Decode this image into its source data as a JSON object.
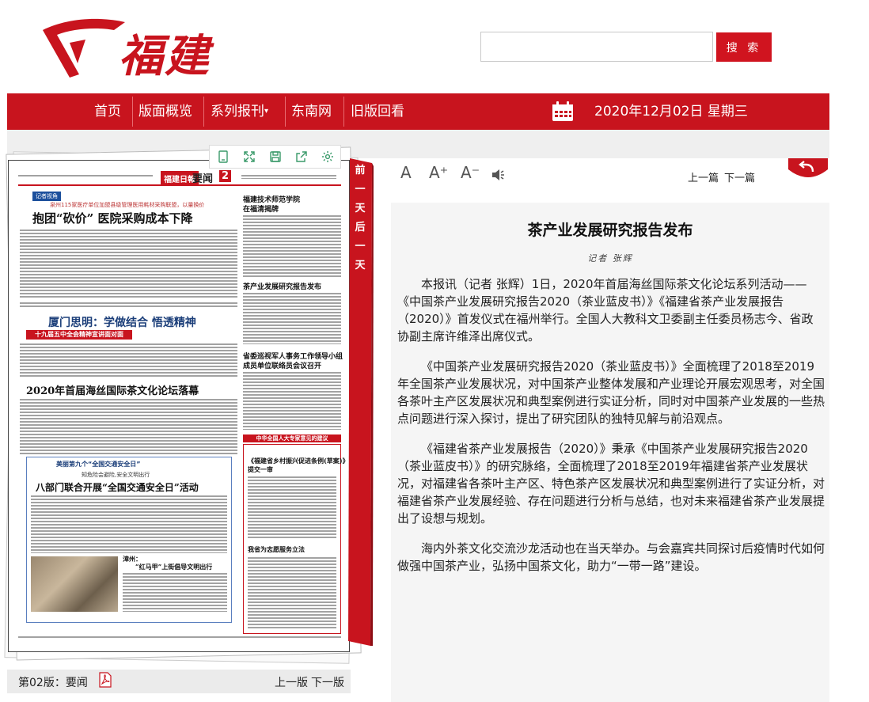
{
  "header": {
    "logo_text": "福建日報",
    "search": {
      "placeholder": "",
      "button_label": "搜 索"
    }
  },
  "nav": {
    "items": [
      "首页",
      "版面概览",
      "系列报刊",
      "东南网",
      "旧版回看"
    ],
    "dropdown_marker": "▾",
    "date": "2020年12月02日 星期三"
  },
  "newspaper": {
    "masthead": "福建日報",
    "section": "要闻",
    "page_no": "2",
    "tag": "记者视角",
    "kicker": "泉州115家医疗单位加盟县级管理医用耗材采购联盟，以量换价",
    "headline_1": "抱团“砍价” 医院采购成本下降",
    "headline_2": "厦门思明：学做结合 悟透精神",
    "red_bar_1": "十九届五中全会精神宣讲面对面",
    "headline_3": "2020年首届海丝国际茶文化论坛落幕",
    "small_head_1": "福建技术师范学院",
    "small_head_1b": "在福清揭牌",
    "small_head_2": "茶产业发展研究报告发布",
    "small_head_3": "省委巡视军人事务工作领导小组",
    "small_head_3b": "成员单位联络员会议召开",
    "red_bar_2": "中华全国人大专家意见的建议",
    "small_head_4": "《福建省乡村振兴促进条例(草案)》",
    "small_head_4b": "提交一审",
    "small_head_5": "我省为志愿服务立法",
    "boxed_kicker": "美丽第九个“全国交通安全日”",
    "boxed_sub": "知危险会避险,安全文明出行",
    "headline_4": "八部门联合开展“全国交通安全日”活动",
    "small_head_6": "漳州：",
    "small_head_6b": "“红马甲”上街倡导文明出行"
  },
  "page_footer": {
    "label": "第02版：要闻",
    "prev": "上一版",
    "next": "下一版"
  },
  "ribbon": {
    "chars": [
      "前",
      "一",
      "天",
      "后",
      "一",
      "天"
    ]
  },
  "article_tools": {
    "font_normal": "A",
    "font_larger": "A⁺",
    "font_smaller": "A⁻",
    "prev": "上一篇",
    "next": "下一篇"
  },
  "article": {
    "title": "茶产业发展研究报告发布",
    "author": "记者 张辉",
    "paragraphs": [
      "本报讯（记者 张辉）1日，2020年首届海丝国际茶文化论坛系列活动——《中国茶产业发展研究报告2020（茶业蓝皮书）》《福建省茶产业发展报告（2020）》首发仪式在福州举行。全国人大教科文卫委副主任委员杨志今、省政协副主席许维泽出席仪式。",
      "《中国茶产业发展研究报告2020（茶业蓝皮书）》全面梳理了2018至2019年全国茶产业发展状况，对中国茶产业整体发展和产业理论开展宏观思考，对全国各茶叶主产区发展状况和典型案例进行实证分析，同时对中国茶产业发展的一些热点问题进行深入探讨，提出了研究团队的独特见解与前沿观点。",
      "《福建省茶产业发展报告（2020）》秉承《中国茶产业发展研究报告2020（茶业蓝皮书）》的研究脉络，全面梳理了2018至2019年福建省茶产业发展状况，对福建省各茶叶主产区、特色茶产区发展状况和典型案例进行了实证分析，对福建省茶产业发展经验、存在问题进行分析与总结，也对未来福建省茶产业发展提出了设想与规划。",
      "海内外茶文化交流沙龙活动也在当天举办。与会嘉宾共同探讨后疫情时代如何做强中国茶产业，弘扬中国茶文化，助力“一带一路”建设。"
    ]
  },
  "colors": {
    "brand_red": "#c8141e",
    "nav_text": "#ffffff",
    "article_bg": "#f5f5f5"
  }
}
